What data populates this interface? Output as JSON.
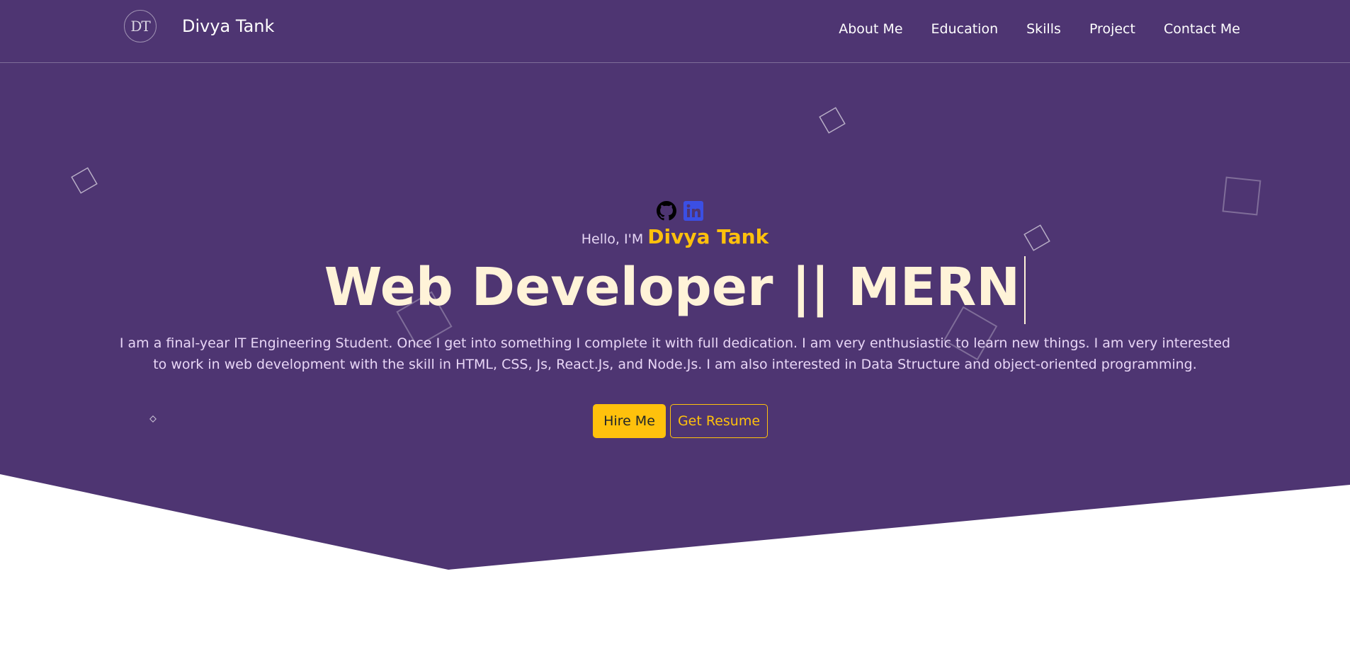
{
  "colors": {
    "hero_background": "#4e3572",
    "accent": "#ffc10c",
    "headline": "#fff3d8",
    "body_text": "#e8d6f6",
    "page_background": "#ffffff",
    "linkedin": "#3b4fe4"
  },
  "navbar": {
    "logo_monogram": "DT",
    "brand_name": "Divya Tank",
    "links": [
      "About Me",
      "Education",
      "Skills",
      "Project",
      "Contact Me"
    ]
  },
  "hero": {
    "socials": [
      "github-icon",
      "linkedin-icon"
    ],
    "greeting_prefix": "Hello, I'M",
    "greeting_name": "Divya Tank",
    "headline": "Web Developer || MERN",
    "bio": "I am a final-year IT Engineering Student. Once I get into something I complete it with full dedication. I am very enthusiastic to learn new things. I am very interested to work in web development with the skill in HTML, CSS, Js, React.Js, and Node.Js. I am also interested in Data Structure and object-oriented programming.",
    "hire_button": "Hire Me",
    "resume_button": "Get Resume"
  }
}
